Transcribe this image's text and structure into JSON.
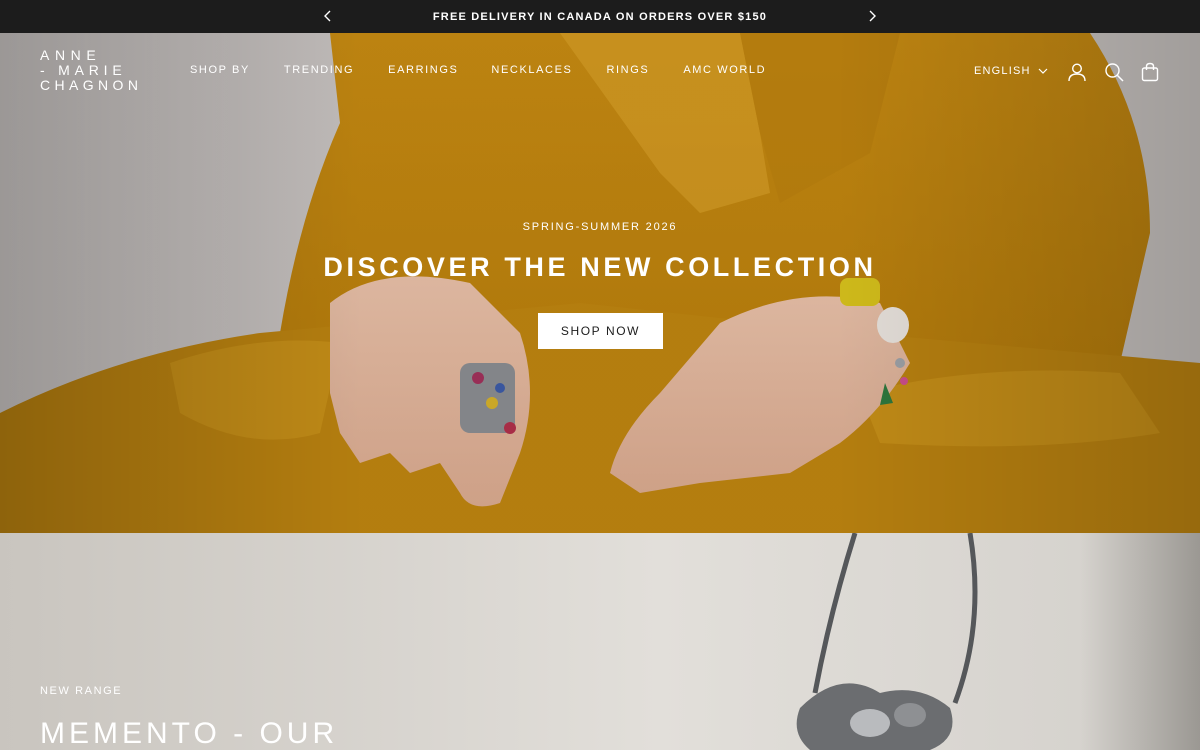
{
  "announcement": {
    "text": "FREE DELIVERY IN CANADA ON ORDERS OVER $150",
    "prev_icon": "chevron-left-icon",
    "next_icon": "chevron-right-icon"
  },
  "header": {
    "logo_lines": [
      "ANNE",
      "- MARIE",
      "CHAGNON"
    ],
    "nav": [
      "SHOP BY",
      "TRENDING",
      "EARRINGS",
      "NECKLACES",
      "RINGS",
      "AMC WORLD"
    ],
    "language": "ENGLISH",
    "icons": [
      "chevron-down-icon",
      "account-icon",
      "search-icon",
      "cart-icon"
    ]
  },
  "hero": {
    "eyebrow": "SPRING-SUMMER 2026",
    "title": "DISCOVER THE NEW COLLECTION",
    "cta": "SHOP NOW"
  },
  "section2": {
    "eyebrow": "NEW RANGE",
    "title": "MEMENTO - OUR"
  },
  "colors": {
    "announcement_bg": "#1c1c1c",
    "text_light": "#ffffff",
    "text_dark": "#1c1c1c",
    "mustard": "#c98e14"
  }
}
